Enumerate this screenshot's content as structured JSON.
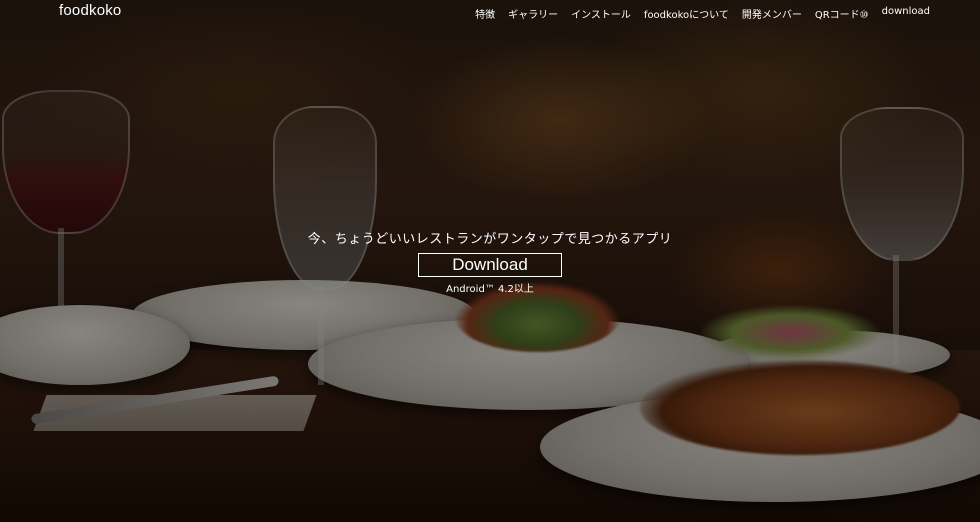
{
  "brand": {
    "logo": "foodkoko"
  },
  "nav": {
    "items": [
      {
        "label": "特徴"
      },
      {
        "label": "ギャラリー"
      },
      {
        "label": "インストール"
      },
      {
        "label": "foodkokoについて"
      },
      {
        "label": "開発メンバー"
      },
      {
        "label": "QRコード⑩"
      },
      {
        "label": "download"
      }
    ]
  },
  "hero": {
    "tagline": "今、ちょうどいいレストランがワンタップで見つかるアプリ",
    "download_label": "Download",
    "requirement": "Android™ 4.2以上",
    "background_icon": "restaurant-table-photo"
  },
  "colors": {
    "text": "#ffffff",
    "overlay": "rgba(0,0,0,0.38)"
  }
}
